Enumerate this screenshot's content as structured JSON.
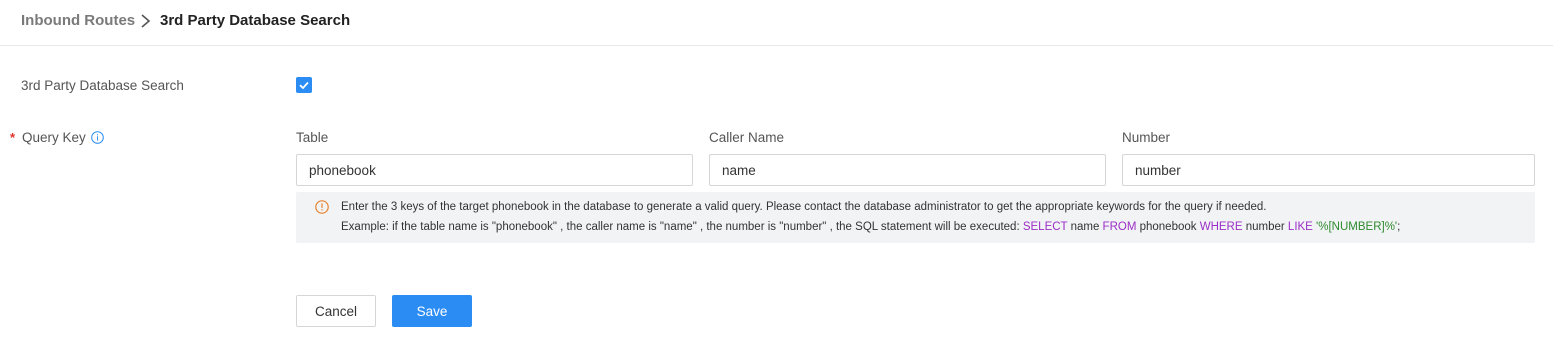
{
  "breadcrumb": {
    "parent": "Inbound Routes",
    "current": "3rd Party Database Search"
  },
  "form": {
    "search_label": "3rd Party Database Search",
    "search_enabled": true,
    "query_key_label": "Query Key",
    "required_marker": "*",
    "columns": {
      "table_label": "Table",
      "caller_name_label": "Caller Name",
      "number_label": "Number"
    },
    "values": {
      "table": "phonebook",
      "caller_name": "name",
      "number": "number"
    },
    "hint": {
      "line1": "Enter the 3 keys of the target phonebook in the database to generate a valid query. Please contact the database administrator to get the appropriate keywords for the query if needed.",
      "line2_prefix": "Example: if the table name is \"phonebook\" , the caller name is \"name\" , the number is \"number\" , the SQL statement will be executed: ",
      "sql": {
        "select": "SELECT",
        "field": " name ",
        "from": "FROM",
        "table": " phonebook ",
        "where": "WHERE",
        "number_field": " number ",
        "like": "LIKE",
        "pattern": " '%[NUMBER]%'",
        "terminator": ";"
      }
    }
  },
  "actions": {
    "cancel_label": "Cancel",
    "save_label": "Save"
  },
  "colors": {
    "accent": "#2b8cf4",
    "required": "#e0322b",
    "sql_keyword": "#9b2fc7",
    "sql_string": "#2e8b2e",
    "warning": "#e8812d"
  },
  "icons": {
    "breadcrumb_separator": "chevron-right-icon",
    "query_key_info": "info-circle-icon",
    "hint": "exclamation-circle-icon",
    "checkbox": "checkmark-icon"
  }
}
